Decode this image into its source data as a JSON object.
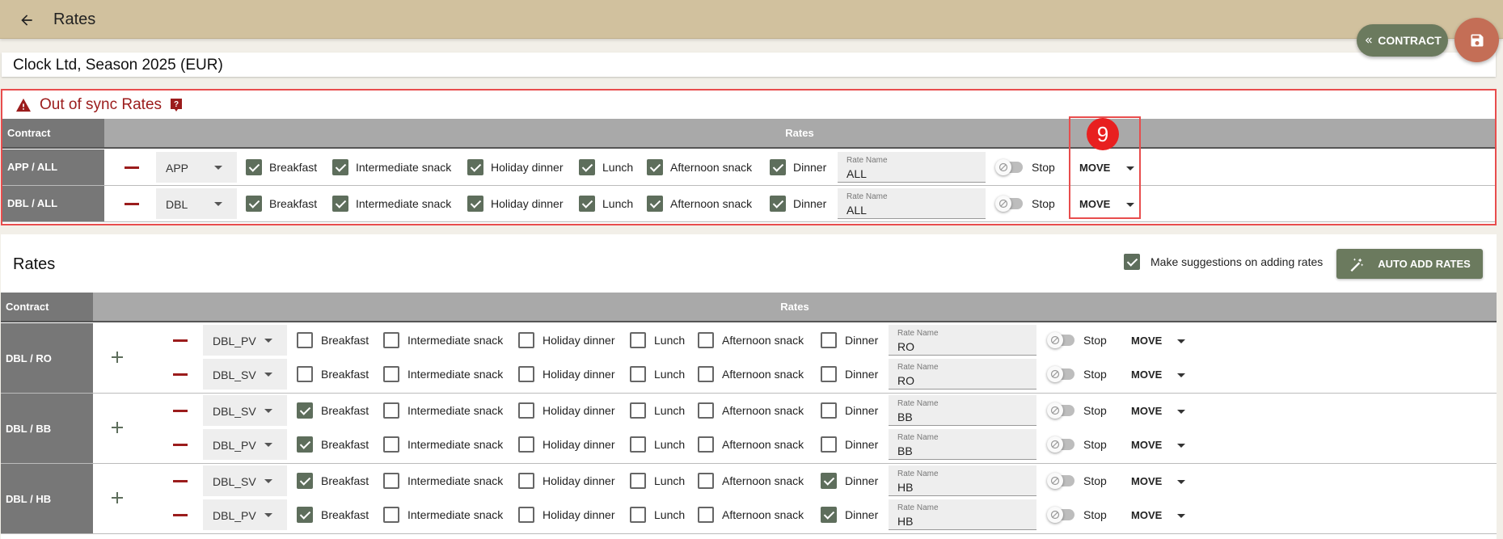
{
  "header": {
    "title": "Rates",
    "contract_button": "CONTRACT"
  },
  "contract_title": "Clock Ltd, Season 2025 (EUR)",
  "out_of_sync": {
    "title": "Out of sync Rates",
    "col_contract": "Contract",
    "col_rates": "Rates",
    "rows": [
      {
        "label": "APP / ALL",
        "select": "APP",
        "checks": [
          true,
          true,
          true,
          true,
          true,
          true
        ],
        "rate_name": "ALL"
      },
      {
        "label": "DBL / ALL",
        "select": "DBL",
        "checks": [
          true,
          true,
          true,
          true,
          true,
          true
        ],
        "rate_name": "ALL"
      }
    ]
  },
  "meals": [
    "Breakfast",
    "Intermediate snack",
    "Holiday dinner",
    "Lunch",
    "Afternoon snack",
    "Dinner"
  ],
  "rate_name_label": "Rate Name",
  "stop_label": "Stop",
  "move_label": "MOVE",
  "annotation_number": "9",
  "rates": {
    "title": "Rates",
    "suggestions_label": "Make suggestions on adding rates",
    "suggestions_checked": true,
    "auto_add_label": "AUTO ADD RATES",
    "col_contract": "Contract",
    "col_rates": "Rates",
    "groups": [
      {
        "label": "DBL / RO",
        "rows": [
          {
            "select": "DBL_PV",
            "checks": [
              false,
              false,
              false,
              false,
              false,
              false
            ],
            "rate_name": "RO"
          },
          {
            "select": "DBL_SV",
            "checks": [
              false,
              false,
              false,
              false,
              false,
              false
            ],
            "rate_name": "RO"
          }
        ]
      },
      {
        "label": "DBL / BB",
        "rows": [
          {
            "select": "DBL_SV",
            "checks": [
              true,
              false,
              false,
              false,
              false,
              false
            ],
            "rate_name": "BB"
          },
          {
            "select": "DBL_PV",
            "checks": [
              true,
              false,
              false,
              false,
              false,
              false
            ],
            "rate_name": "BB"
          }
        ]
      },
      {
        "label": "DBL / HB",
        "rows": [
          {
            "select": "DBL_SV",
            "checks": [
              true,
              false,
              false,
              false,
              false,
              true
            ],
            "rate_name": "HB"
          },
          {
            "select": "DBL_PV",
            "checks": [
              true,
              false,
              false,
              false,
              false,
              true
            ],
            "rate_name": "HB"
          }
        ]
      }
    ]
  },
  "colors": {
    "topbar": "#d1c19e",
    "accent_green": "#6b7a5e",
    "save_fab": "#c46e56",
    "warning_red": "#9b1c1c",
    "highlight": "#e84d4d"
  }
}
